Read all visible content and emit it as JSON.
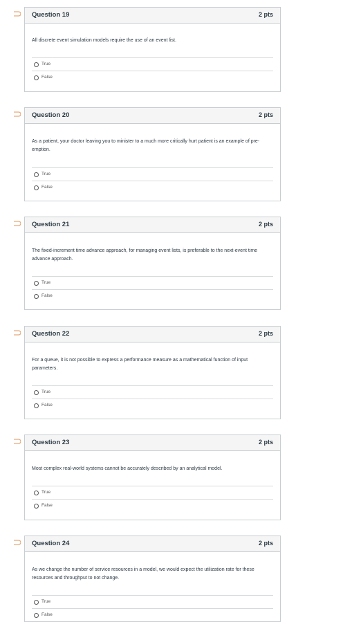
{
  "questions": [
    {
      "title": "Question 19",
      "points": "2 pts",
      "text": "All discrete event simulation models require the use of an event list.",
      "options": [
        "True",
        "False"
      ]
    },
    {
      "title": "Question 20",
      "points": "2 pts",
      "text": "As a patient, your doctor leaving you to minister to a much more critically hurt patient is an example of pre-emption.",
      "options": [
        "True",
        "False"
      ]
    },
    {
      "title": "Question 21",
      "points": "2 pts",
      "text": "The fixed-increment time advance approach, for managing event lists, is preferable to the next-event time advance approach.",
      "options": [
        "True",
        "False"
      ]
    },
    {
      "title": "Question 22",
      "points": "2 pts",
      "text": "For a queue, it is not possible to express a performance measure as a mathematical function of input parameters.",
      "options": [
        "True",
        "False"
      ]
    },
    {
      "title": "Question 23",
      "points": "2 pts",
      "text": "Most complex real-world systems cannot be accurately described by an analytical model.",
      "options": [
        "True",
        "False"
      ]
    },
    {
      "title": "Question 24",
      "points": "2 pts",
      "text": "As we change the number of service resources in a model, we would expect the utilization rate for these resources and throughput to not change.",
      "options": [
        "True",
        "False"
      ]
    }
  ],
  "colors": {
    "flag": "#e8a97a",
    "border": "#c7cdd1",
    "header_bg": "#f5f5f5"
  }
}
